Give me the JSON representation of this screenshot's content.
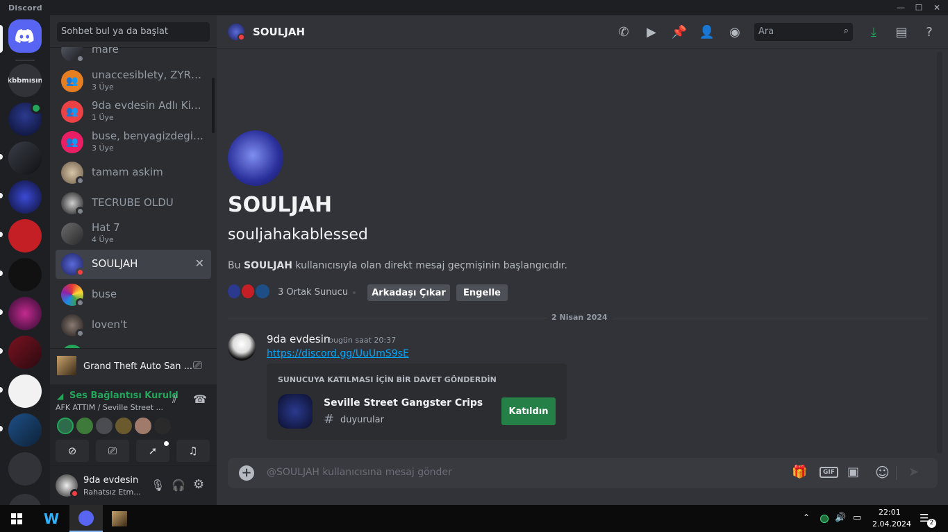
{
  "app": {
    "title": "Discord"
  },
  "window": {
    "minimize": "—",
    "maximize": "☐",
    "close": "✕"
  },
  "guilds": [
    {
      "name": "home",
      "label": ""
    },
    {
      "name": "kbbmisin",
      "label": "kbbmısın"
    }
  ],
  "dm": {
    "search_placeholder": "Sohbet bul ya da başlat",
    "items": [
      {
        "name": "mare",
        "sub": ""
      },
      {
        "name": "unaccesiblety, ZYRXN...",
        "sub": "3 Üye"
      },
      {
        "name": "9da evdesin Adlı Kişin...",
        "sub": "1 Üye"
      },
      {
        "name": "buse, benyagizdegilim1",
        "sub": "3 Üye"
      },
      {
        "name": "tamam askim",
        "sub": ""
      },
      {
        "name": "TECRUBE OLDU",
        "sub": ""
      },
      {
        "name": "Hat 7",
        "sub": "4 Üye"
      },
      {
        "name": "SOULJAH",
        "sub": ""
      },
      {
        "name": "buse",
        "sub": ""
      },
      {
        "name": "loven't",
        "sub": ""
      }
    ],
    "close_glyph": "✕"
  },
  "activity": {
    "title": "Grand Theft Auto San ..."
  },
  "voice": {
    "status": "Ses Bağlantısı Kuruld",
    "channel": "AFK ATTIM / Seville Street ..."
  },
  "user": {
    "name": "9da evdesin",
    "status": "Rahatsız Etm..."
  },
  "channel": {
    "title": "SOULJAH",
    "search_placeholder": "Ara"
  },
  "profile": {
    "display_name": "SOULJAH",
    "username": "souljahakablessed",
    "intro_pre": "Bu ",
    "intro_name": "SOULJAH",
    "intro_post": " kullanıcısıyla olan direkt mesaj geçmişinin başlangıcıdır.",
    "mutual": "3 Ortak Sunucu",
    "remove_friend": "Arkadaşı Çıkar",
    "block": "Engelle"
  },
  "divider_date": "2 Nisan 2024",
  "message": {
    "author": "9da evdesin",
    "timestamp": "bugün saat 20:37",
    "link": "https://discord.gg/UuUmS9sE",
    "invite_header": "SUNUCUYA KATILMASI İÇİN BİR DAVET GÖNDERDİN",
    "server_name": "Seville Street Gangster Crips",
    "channel_hash": "#",
    "channel_name": "duyurular",
    "joined_label": "Katıldın"
  },
  "composer": {
    "placeholder": "@SOULJAH kullanıcısına mesaj gönder",
    "gif": "GIF"
  },
  "taskbar": {
    "time": "22:01",
    "date": "2.04.2024",
    "notif_count": "2"
  },
  "colors": {
    "accent": "#5865f2",
    "green": "#23a55a",
    "link": "#00a8fc",
    "dnd": "#f23f43"
  }
}
